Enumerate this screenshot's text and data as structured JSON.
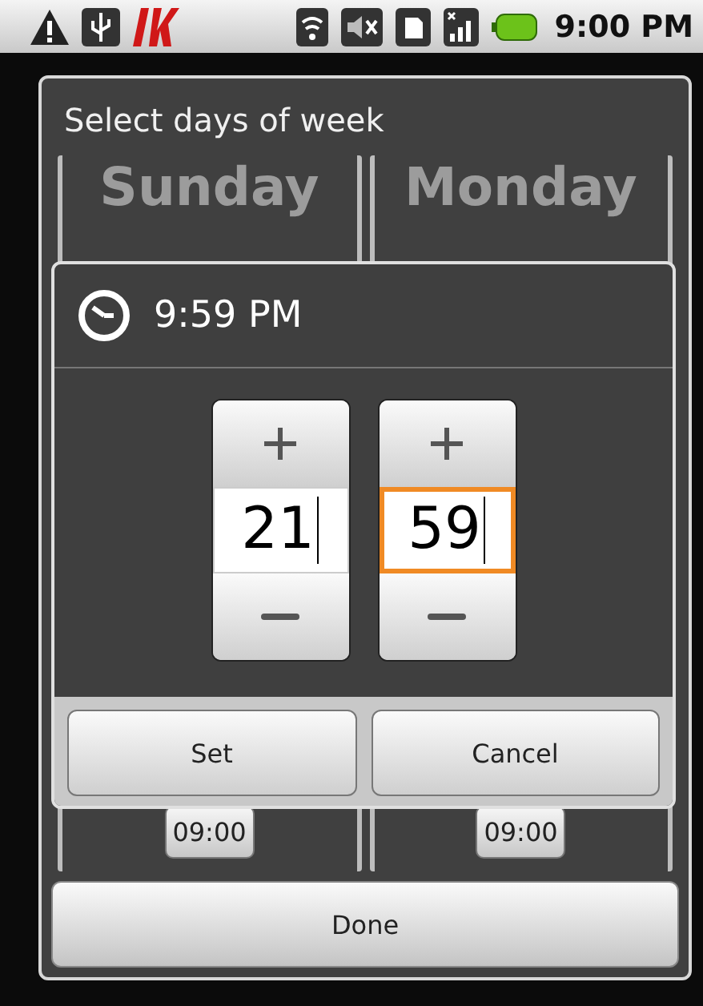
{
  "status_bar": {
    "time": "9:00 PM"
  },
  "days_dialog": {
    "title": "Select days of week",
    "days": [
      {
        "name": "Sunday",
        "time": "09:00"
      },
      {
        "name": "Monday",
        "time": "09:00"
      }
    ],
    "done": "Done"
  },
  "time_dialog": {
    "title": "9:59 PM",
    "spinners": [
      {
        "value": "21",
        "focused": false
      },
      {
        "value": "59",
        "focused": true
      }
    ],
    "buttons": [
      "Set",
      "Cancel"
    ]
  }
}
